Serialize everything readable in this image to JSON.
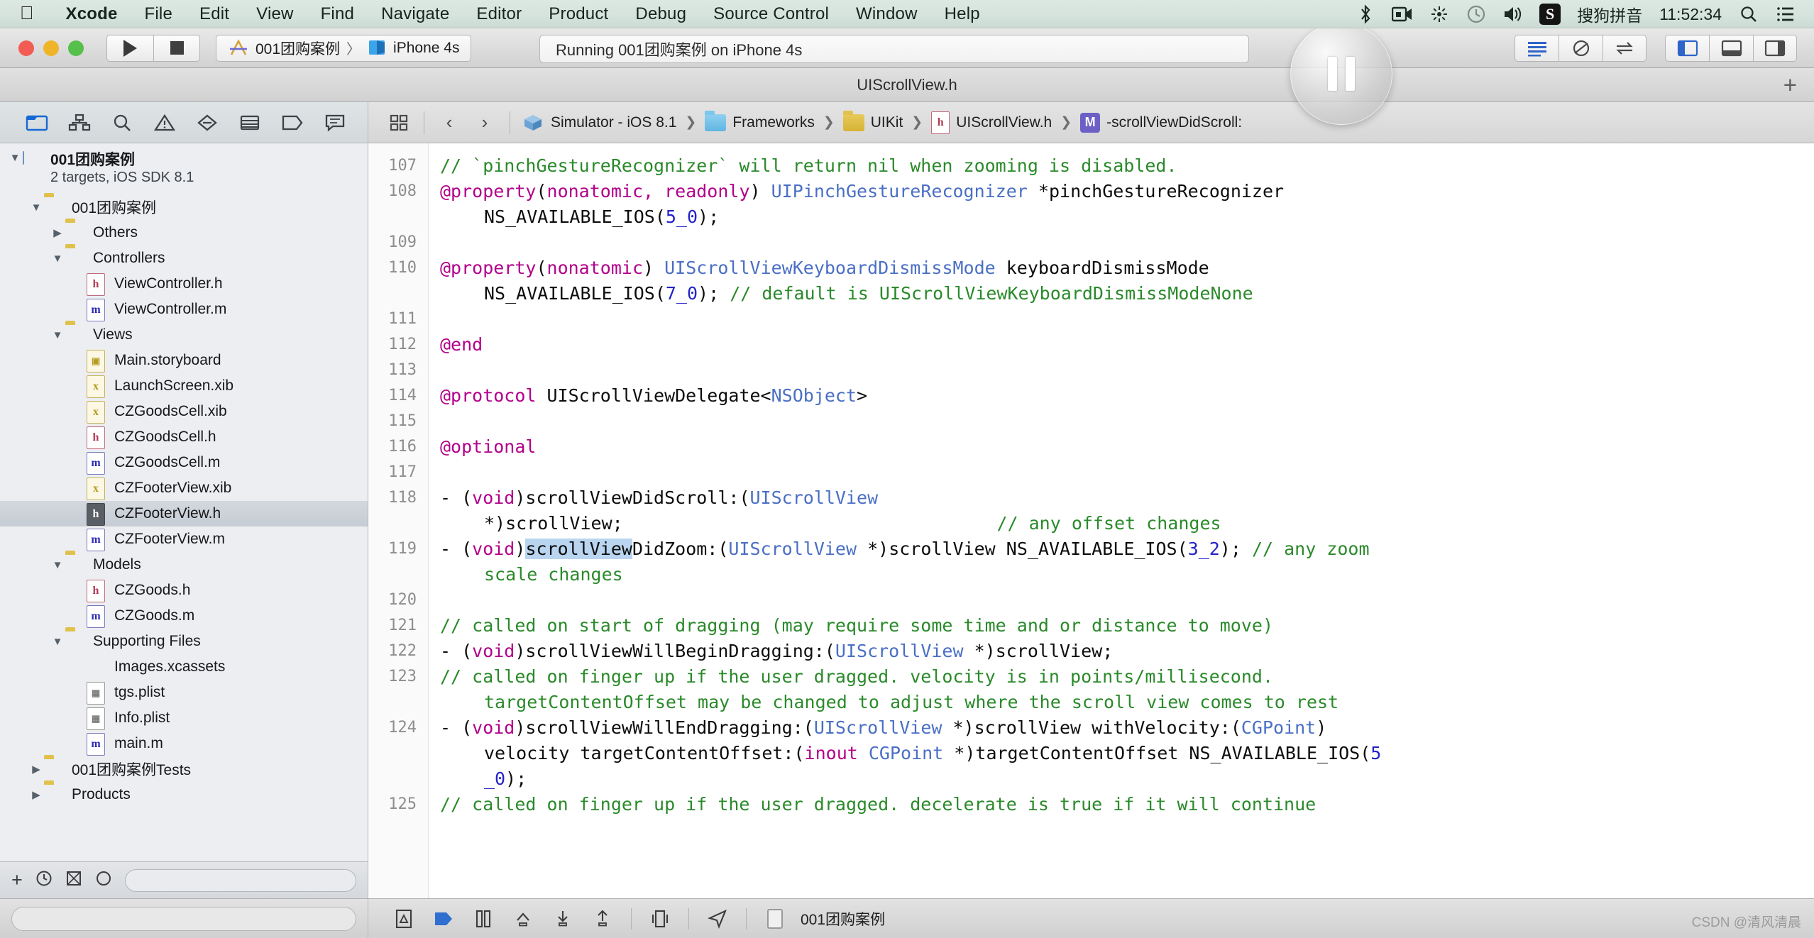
{
  "menubar": {
    "apple": "apple-logo",
    "items": [
      {
        "label": "Xcode",
        "bold": true
      },
      {
        "label": "File",
        "bold": false
      },
      {
        "label": "Edit",
        "bold": false
      },
      {
        "label": "View",
        "bold": false
      },
      {
        "label": "Find",
        "bold": false
      },
      {
        "label": "Navigate",
        "bold": false
      },
      {
        "label": "Editor",
        "bold": false
      },
      {
        "label": "Product",
        "bold": false
      },
      {
        "label": "Debug",
        "bold": false
      },
      {
        "label": "Source Control",
        "bold": false
      },
      {
        "label": "Window",
        "bold": false
      },
      {
        "label": "Help",
        "bold": false
      }
    ],
    "ime_badge": "S",
    "ime_label": "搜狗拼音",
    "clock": "11:52:34"
  },
  "toolbar": {
    "run_button": "Run",
    "stop_button": "Stop",
    "scheme_name": "001团购案例",
    "scheme_separator": "〉",
    "destination": "iPhone 4s",
    "status_text": "Running 001团购案例 on iPhone 4s"
  },
  "titlebar": {
    "title": "UIScrollView.h",
    "add_button": "+"
  },
  "navigator": {
    "tabs": [
      {
        "name": "project-navigator",
        "active": true
      },
      {
        "name": "symbol-navigator",
        "active": false
      },
      {
        "name": "find-navigator",
        "active": false
      },
      {
        "name": "issue-navigator",
        "active": false
      },
      {
        "name": "test-navigator",
        "active": false
      },
      {
        "name": "debug-navigator",
        "active": false
      },
      {
        "name": "breakpoint-navigator",
        "active": false
      },
      {
        "name": "report-navigator",
        "active": false
      }
    ],
    "tree": [
      {
        "label": "001团购案例",
        "sub": "2 targets, iOS SDK 8.1",
        "indent": 0,
        "disc": "down",
        "icon": "project",
        "bold": true,
        "selected": false
      },
      {
        "label": "001团购案例",
        "sub": "",
        "indent": 1,
        "disc": "down",
        "icon": "folder",
        "bold": false,
        "selected": false
      },
      {
        "label": "Others",
        "sub": "",
        "indent": 2,
        "disc": "right",
        "icon": "folder",
        "bold": false,
        "selected": false
      },
      {
        "label": "Controllers",
        "sub": "",
        "indent": 2,
        "disc": "down",
        "icon": "folder",
        "bold": false,
        "selected": false
      },
      {
        "label": "ViewController.h",
        "sub": "",
        "indent": 3,
        "disc": "none",
        "icon": "h",
        "bold": false,
        "selected": false
      },
      {
        "label": "ViewController.m",
        "sub": "",
        "indent": 3,
        "disc": "none",
        "icon": "m",
        "bold": false,
        "selected": false
      },
      {
        "label": "Views",
        "sub": "",
        "indent": 2,
        "disc": "down",
        "icon": "folder",
        "bold": false,
        "selected": false
      },
      {
        "label": "Main.storyboard",
        "sub": "",
        "indent": 3,
        "disc": "none",
        "icon": "sb",
        "bold": false,
        "selected": false
      },
      {
        "label": "LaunchScreen.xib",
        "sub": "",
        "indent": 3,
        "disc": "none",
        "icon": "xib",
        "bold": false,
        "selected": false
      },
      {
        "label": "CZGoodsCell.xib",
        "sub": "",
        "indent": 3,
        "disc": "none",
        "icon": "xib",
        "bold": false,
        "selected": false
      },
      {
        "label": "CZGoodsCell.h",
        "sub": "",
        "indent": 3,
        "disc": "none",
        "icon": "h",
        "bold": false,
        "selected": false
      },
      {
        "label": "CZGoodsCell.m",
        "sub": "",
        "indent": 3,
        "disc": "none",
        "icon": "m",
        "bold": false,
        "selected": false
      },
      {
        "label": "CZFooterView.xib",
        "sub": "",
        "indent": 3,
        "disc": "none",
        "icon": "xib",
        "bold": false,
        "selected": false
      },
      {
        "label": "CZFooterView.h",
        "sub": "",
        "indent": 3,
        "disc": "none",
        "icon": "h",
        "bold": false,
        "selected": true
      },
      {
        "label": "CZFooterView.m",
        "sub": "",
        "indent": 3,
        "disc": "none",
        "icon": "m",
        "bold": false,
        "selected": false
      },
      {
        "label": "Models",
        "sub": "",
        "indent": 2,
        "disc": "down",
        "icon": "folder",
        "bold": false,
        "selected": false
      },
      {
        "label": "CZGoods.h",
        "sub": "",
        "indent": 3,
        "disc": "none",
        "icon": "h",
        "bold": false,
        "selected": false
      },
      {
        "label": "CZGoods.m",
        "sub": "",
        "indent": 3,
        "disc": "none",
        "icon": "m",
        "bold": false,
        "selected": false
      },
      {
        "label": "Supporting Files",
        "sub": "",
        "indent": 2,
        "disc": "down",
        "icon": "folder",
        "bold": false,
        "selected": false
      },
      {
        "label": "Images.xcassets",
        "sub": "",
        "indent": 3,
        "disc": "none",
        "icon": "xcassets",
        "bold": false,
        "selected": false
      },
      {
        "label": "tgs.plist",
        "sub": "",
        "indent": 3,
        "disc": "none",
        "icon": "plist",
        "bold": false,
        "selected": false
      },
      {
        "label": "Info.plist",
        "sub": "",
        "indent": 3,
        "disc": "none",
        "icon": "plist",
        "bold": false,
        "selected": false
      },
      {
        "label": "main.m",
        "sub": "",
        "indent": 3,
        "disc": "none",
        "icon": "m",
        "bold": false,
        "selected": false
      },
      {
        "label": "001团购案例Tests",
        "sub": "",
        "indent": 1,
        "disc": "right",
        "icon": "folder",
        "bold": false,
        "selected": false
      },
      {
        "label": "Products",
        "sub": "",
        "indent": 1,
        "disc": "right",
        "icon": "folder",
        "bold": false,
        "selected": false
      }
    ]
  },
  "jumpbar": {
    "back": "‹",
    "forward": "›",
    "crumbs": [
      {
        "label": "Simulator - iOS 8.1",
        "icon": "simulator-icon"
      },
      {
        "label": "Frameworks",
        "icon": "folder-blue-icon"
      },
      {
        "label": "UIKit",
        "icon": "folder-yellow-icon"
      },
      {
        "label": "UIScrollView.h",
        "icon": "h-file-icon"
      },
      {
        "label": "-scrollViewDidScroll:",
        "icon": "method-badge"
      }
    ],
    "method_badge": "M"
  },
  "code": {
    "first_line_number": 107,
    "lines": [
      {
        "n": "107",
        "segments": [
          {
            "t": "// `pinchGestureRecognizer` will return nil when zooming is disabled.",
            "c": "cm"
          }
        ]
      },
      {
        "n": "108",
        "segments": [
          {
            "t": "@property",
            "c": "kw"
          },
          {
            "t": "(",
            "c": "pl"
          },
          {
            "t": "nonatomic, readonly",
            "c": "kw"
          },
          {
            "t": ") ",
            "c": "pl"
          },
          {
            "t": "UIPinchGestureRecognizer",
            "c": "ty"
          },
          {
            "t": " *pinchGestureRecognizer",
            "c": "pl"
          }
        ]
      },
      {
        "n": "",
        "indent": true,
        "segments": [
          {
            "t": "NS_AVAILABLE_IOS(",
            "c": "pl"
          },
          {
            "t": "5_0",
            "c": "num"
          },
          {
            "t": ");",
            "c": "pl"
          }
        ]
      },
      {
        "n": "109",
        "segments": []
      },
      {
        "n": "110",
        "segments": [
          {
            "t": "@property",
            "c": "kw"
          },
          {
            "t": "(",
            "c": "pl"
          },
          {
            "t": "nonatomic",
            "c": "kw"
          },
          {
            "t": ") ",
            "c": "pl"
          },
          {
            "t": "UIScrollViewKeyboardDismissMode",
            "c": "ty"
          },
          {
            "t": " keyboardDismissMode",
            "c": "pl"
          }
        ]
      },
      {
        "n": "",
        "indent": true,
        "segments": [
          {
            "t": "NS_AVAILABLE_IOS(",
            "c": "pl"
          },
          {
            "t": "7_0",
            "c": "num"
          },
          {
            "t": "); ",
            "c": "pl"
          },
          {
            "t": "// default is UIScrollViewKeyboardDismissModeNone",
            "c": "cm"
          }
        ]
      },
      {
        "n": "111",
        "segments": []
      },
      {
        "n": "112",
        "segments": [
          {
            "t": "@end",
            "c": "kw"
          }
        ]
      },
      {
        "n": "113",
        "segments": []
      },
      {
        "n": "114",
        "segments": [
          {
            "t": "@protocol",
            "c": "kw"
          },
          {
            "t": " UIScrollViewDelegate<",
            "c": "pl"
          },
          {
            "t": "NSObject",
            "c": "ty"
          },
          {
            "t": ">",
            "c": "pl"
          }
        ]
      },
      {
        "n": "115",
        "segments": []
      },
      {
        "n": "116",
        "segments": [
          {
            "t": "@optional",
            "c": "kw"
          }
        ]
      },
      {
        "n": "117",
        "segments": []
      },
      {
        "n": "118",
        "segments": [
          {
            "t": "- (",
            "c": "pl"
          },
          {
            "t": "void",
            "c": "kw"
          },
          {
            "t": ")scrollViewDidScroll:(",
            "c": "pl"
          },
          {
            "t": "UIScrollView",
            "c": "ty"
          },
          {
            "t": "",
            "c": "pl"
          }
        ]
      },
      {
        "n": "",
        "indent": true,
        "segments": [
          {
            "t": "*)scrollView;",
            "c": "pl"
          },
          {
            "t": "                                   ",
            "c": "pl"
          },
          {
            "t": "// any offset changes",
            "c": "cm"
          }
        ]
      },
      {
        "n": "119",
        "segments": [
          {
            "t": "- (",
            "c": "pl"
          },
          {
            "t": "void",
            "c": "kw"
          },
          {
            "t": ")",
            "c": "pl"
          },
          {
            "t": "scrollView",
            "c": "hl"
          },
          {
            "t": "DidZoom:(",
            "c": "pl"
          },
          {
            "t": "UIScrollView",
            "c": "ty"
          },
          {
            "t": " *)scrollView NS_AVAILABLE_IOS(",
            "c": "pl"
          },
          {
            "t": "3_2",
            "c": "num"
          },
          {
            "t": "); ",
            "c": "pl"
          },
          {
            "t": "// any zoom",
            "c": "cm"
          }
        ]
      },
      {
        "n": "",
        "indent": true,
        "segments": [
          {
            "t": "scale changes",
            "c": "cm"
          }
        ]
      },
      {
        "n": "120",
        "segments": []
      },
      {
        "n": "121",
        "segments": [
          {
            "t": "// called on start of dragging (may require some time and or distance to move)",
            "c": "cm"
          }
        ]
      },
      {
        "n": "122",
        "segments": [
          {
            "t": "- (",
            "c": "pl"
          },
          {
            "t": "void",
            "c": "kw"
          },
          {
            "t": ")scrollViewWillBeginDragging:(",
            "c": "pl"
          },
          {
            "t": "UIScrollView",
            "c": "ty"
          },
          {
            "t": " *)scrollView;",
            "c": "pl"
          }
        ]
      },
      {
        "n": "123",
        "segments": [
          {
            "t": "// called on finger up if the user dragged. velocity is in points/millisecond.",
            "c": "cm"
          }
        ]
      },
      {
        "n": "",
        "indent": true,
        "segments": [
          {
            "t": "targetContentOffset may be changed to adjust where the scroll view comes to rest",
            "c": "cm"
          }
        ]
      },
      {
        "n": "124",
        "segments": [
          {
            "t": "- (",
            "c": "pl"
          },
          {
            "t": "void",
            "c": "kw"
          },
          {
            "t": ")scrollViewWillEndDragging:(",
            "c": "pl"
          },
          {
            "t": "UIScrollView",
            "c": "ty"
          },
          {
            "t": " *)scrollView withVelocity:(",
            "c": "pl"
          },
          {
            "t": "CGPoint",
            "c": "ty"
          },
          {
            "t": ")",
            "c": "pl"
          }
        ]
      },
      {
        "n": "",
        "indent": true,
        "segments": [
          {
            "t": "velocity targetContentOffset:(",
            "c": "pl"
          },
          {
            "t": "inout",
            "c": "kw"
          },
          {
            "t": " ",
            "c": "pl"
          },
          {
            "t": "CGPoint",
            "c": "ty"
          },
          {
            "t": " *)targetContentOffset NS_AVAILABLE_IOS(",
            "c": "pl"
          },
          {
            "t": "5",
            "c": "num"
          }
        ]
      },
      {
        "n": "",
        "indent": true,
        "segments": [
          {
            "t": "_0",
            "c": "num"
          },
          {
            "t": ");",
            "c": "pl"
          }
        ]
      },
      {
        "n": "125",
        "segments": [
          {
            "t": "// called on finger up if the user dragged. decelerate is true if it will continue",
            "c": "cm"
          }
        ]
      }
    ]
  },
  "bottombar": {
    "scheme_label": "001团购案例",
    "icons": [
      "breakpoint-icon",
      "continue-icon",
      "step-over-icon",
      "step-into-icon",
      "step-out-icon",
      "simulate-location-icon",
      "view-hierarchy-icon"
    ]
  },
  "watermark": "CSDN @清风清晨",
  "colors": {
    "accent_blue": "#1668d4",
    "comment_green": "#2a8a2a",
    "keyword_magenta": "#b2008a",
    "type_blue": "#4a6fc4",
    "number_blue": "#2323c8",
    "selection_highlight": "#b9d5f0"
  }
}
